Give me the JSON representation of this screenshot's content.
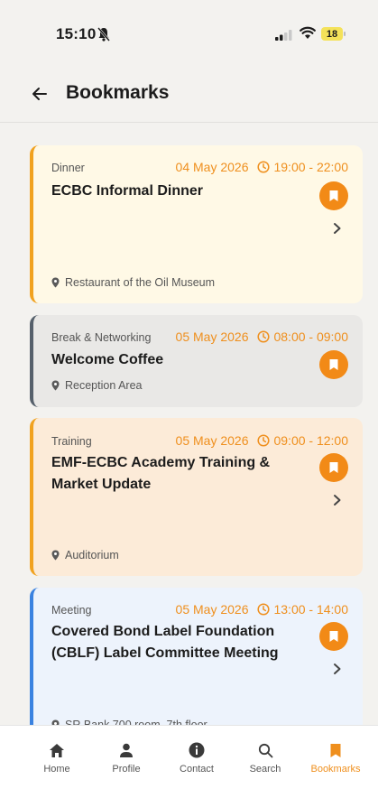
{
  "status": {
    "time": "15:10",
    "battery": "18"
  },
  "header": {
    "title": "Bookmarks"
  },
  "cards": [
    {
      "tag": "Dinner",
      "date": "04 May 2026",
      "time": "19:00 - 22:00",
      "title": "ECBC Informal Dinner",
      "location": "Restaurant of the Oil Museum",
      "accent": "#f1a21f",
      "bg": "#fff9e6"
    },
    {
      "tag": "Break & Networking",
      "date": "05 May 2026",
      "time": "08:00 - 09:00",
      "title": "Welcome Coffee",
      "location": "Reception Area",
      "accent": "#56606b",
      "bg": "#e9e8e6"
    },
    {
      "tag": "Training",
      "date": "05 May 2026",
      "time": "09:00 - 12:00",
      "title": "EMF-ECBC Academy Training & Market Update",
      "location": "Auditorium",
      "accent": "#f1a21f",
      "bg": "#fcebd8"
    },
    {
      "tag": "Meeting",
      "date": "05 May 2026",
      "time": "13:00 - 14:00",
      "title": "Covered Bond Label Foundation (CBLF) Label Committee Meeting",
      "location": "SR Bank 700 room, 7th floor",
      "accent": "#3a82e0",
      "bg": "#edf3fc"
    }
  ],
  "nav": {
    "home": "Home",
    "profile": "Profile",
    "contact": "Contact",
    "search": "Search",
    "bookmarks": "Bookmarks"
  },
  "colors": {
    "accent": "#ef8f1d",
    "bookmark_button": "#f28a17"
  }
}
